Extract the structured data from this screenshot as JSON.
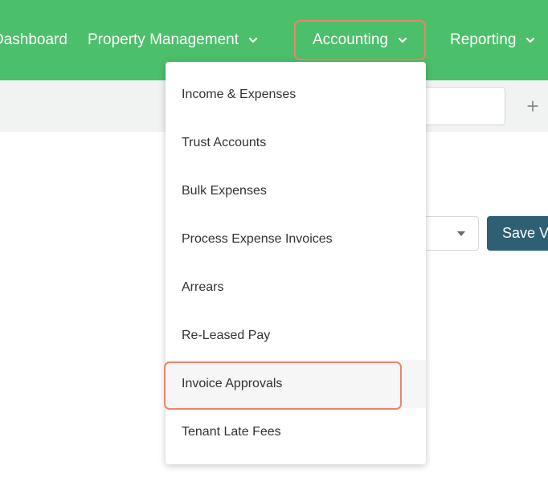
{
  "nav": {
    "items": [
      {
        "label": "Dashboard",
        "has_chevron": false
      },
      {
        "label": "Property Management",
        "has_chevron": true
      },
      {
        "label": "Accounting",
        "has_chevron": true,
        "active": true
      },
      {
        "label": "Reporting",
        "has_chevron": true
      }
    ]
  },
  "toolbar": {
    "search_value": "",
    "add_icon": "plus-icon"
  },
  "controls": {
    "select_value": "",
    "save_label": "Save View"
  },
  "accounting_menu": {
    "items": [
      {
        "label": "Income & Expenses"
      },
      {
        "label": "Trust Accounts"
      },
      {
        "label": "Bulk Expenses"
      },
      {
        "label": "Process Expense Invoices"
      },
      {
        "label": "Arrears"
      },
      {
        "label": "Re-Leased Pay"
      },
      {
        "label": "Invoice Approvals",
        "highlighted": true
      },
      {
        "label": "Tenant Late Fees"
      }
    ]
  },
  "colors": {
    "nav_background": "#4cbf6a",
    "highlight_border": "#e8866c",
    "save_button": "#2e5f72"
  }
}
